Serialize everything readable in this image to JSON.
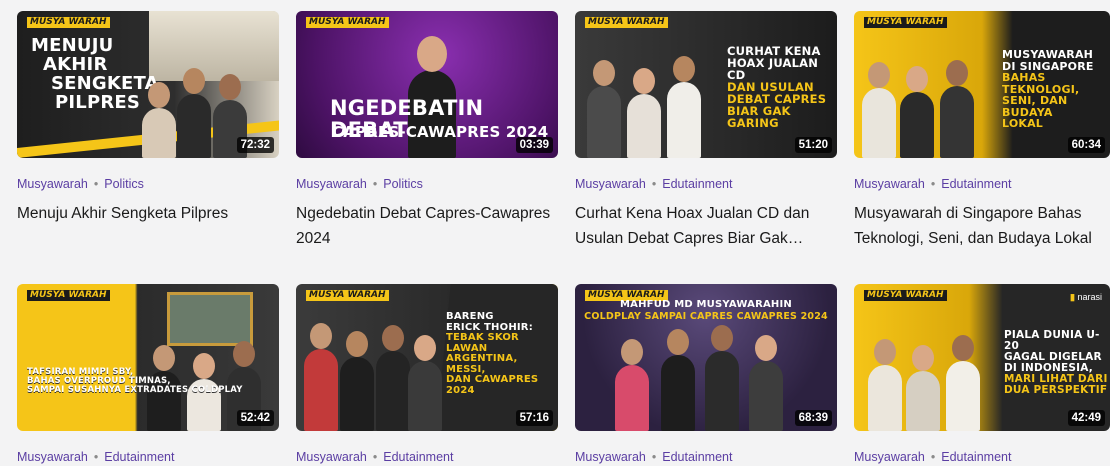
{
  "videos": [
    {
      "channel": "Musyawarah",
      "category": "Politics",
      "title": "Menuju Akhir Sengketa Pilpres",
      "duration": "72:32",
      "thumb_lines": [
        "MENUJU",
        "AKHIR",
        "SENGKETA",
        "PILPRES"
      ],
      "bg": "#2a2a2a",
      "accent": "#f5c518",
      "logo": "MUSYA WARAH"
    },
    {
      "channel": "Musyawarah",
      "category": "Politics",
      "title": "Ngedebatin Debat Capres-Cawapres 2024",
      "duration": "03:39",
      "thumb_lines": [
        "NGEDEBATIN DEBAT",
        "CAPRES-CAWAPRES 2024"
      ],
      "bg": "#5b1a7a",
      "accent": "#ffffff",
      "logo": "MUSYA WARAH"
    },
    {
      "channel": "Musyawarah",
      "category": "Edutainment",
      "title": "Curhat Kena Hoax Jualan CD dan Usulan Debat Capres Biar Gak…",
      "duration": "51:20",
      "thumb_lines": [
        "CURHAT KENA",
        "HOAX JUALAN CD",
        "DAN USULAN",
        "DEBAT CAPRES",
        "BIAR GAK GARING"
      ],
      "bg": "#242424",
      "accent": "#f5c518",
      "logo": "MUSYA WARAH"
    },
    {
      "channel": "Musyawarah",
      "category": "Edutainment",
      "title": "Musyawarah di Singapore Bahas Teknologi, Seni, dan Budaya Lokal",
      "duration": "60:34",
      "thumb_lines": [
        "MUSYAWARAH",
        "DI SINGAPORE",
        "BAHAS TEKNOLOGI,",
        "SENI, DAN BUDAYA",
        "LOKAL"
      ],
      "bg": "#d7a80e",
      "accent": "#1b1b1b",
      "logo": "MUSYA WARAH"
    },
    {
      "channel": "Musyawarah",
      "category": "Edutainment",
      "title": "",
      "duration": "52:42",
      "thumb_lines": [
        "TAFSIRAN MIMPI SBY,",
        "BAHAS OVERPROUD TIMNAS,",
        "SAMPAI SUSAHNYA EXTRADATES COLDPLAY"
      ],
      "bg": "#f5c518",
      "accent": "#ffffff",
      "logo": "MUSYA WARAH"
    },
    {
      "channel": "Musyawarah",
      "category": "Edutainment",
      "title": "",
      "duration": "57:16",
      "thumb_lines": [
        "BARENG",
        "ERICK THOHIR:",
        "TEBAK SKOR LAWAN",
        "ARGENTINA, MESSI,",
        "DAN CAWAPRES",
        "2024"
      ],
      "bg": "#2a2a2a",
      "accent": "#f5c518",
      "logo": "MUSYA WARAH"
    },
    {
      "channel": "Musyawarah",
      "category": "Edutainment",
      "title": "",
      "duration": "68:39",
      "thumb_lines": [
        "MAHFUD MD MUSYAWARAHIN",
        "COLDPLAY SAMPAI CAPRES CAWAPRES 2024"
      ],
      "bg": "#3a2a52",
      "accent": "#f5c518",
      "logo": "MUSYA WARAH"
    },
    {
      "channel": "Musyawarah",
      "category": "Edutainment",
      "title": "",
      "duration": "42:49",
      "thumb_lines": [
        "PIALA DUNIA U-20",
        "GAGAL DIGELAR",
        "DI INDONESIA,",
        "MARI LIHAT DARI",
        "DUA PERSPEKTIF"
      ],
      "bg": "#262626",
      "accent": "#f5c518",
      "logo": "MUSYA WARAH",
      "brand": "narasi"
    }
  ],
  "separator": "•"
}
